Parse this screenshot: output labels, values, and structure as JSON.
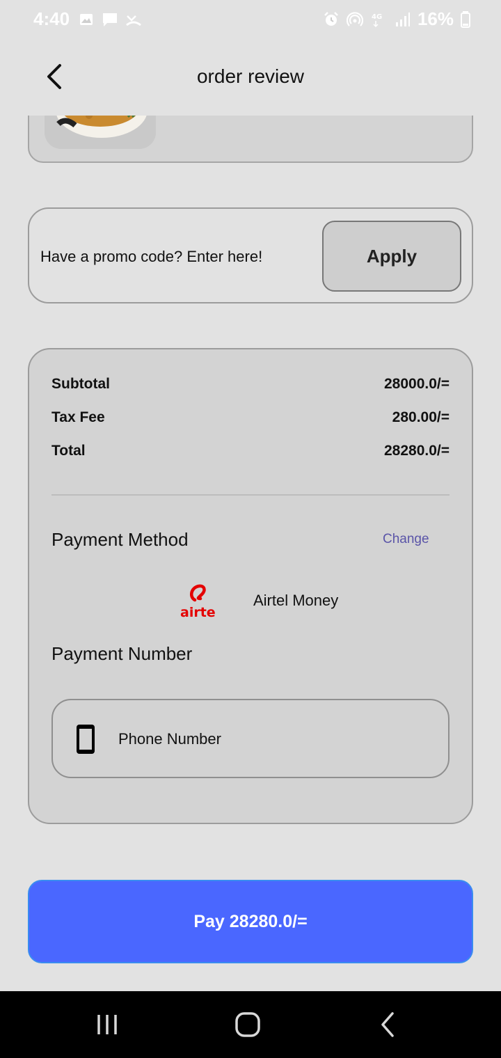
{
  "status_bar": {
    "time": "4:40",
    "battery": "16%",
    "left_icons": [
      "image-icon",
      "chat-icon",
      "missed-call-icon"
    ],
    "right_icons": [
      "alarm-icon",
      "hotspot-icon",
      "4g-icon",
      "signal-icon",
      "battery-icon"
    ]
  },
  "header": {
    "title": "order review",
    "back_icon": "chevron-left-icon"
  },
  "promo": {
    "placeholder": "Have a promo code? Enter here!",
    "apply_label": "Apply"
  },
  "summary": {
    "rows": [
      {
        "label": "Subtotal",
        "value": "28000.0/="
      },
      {
        "label": "Tax Fee",
        "value": "280.00/="
      },
      {
        "label": "Total",
        "value": "28280.0/="
      }
    ]
  },
  "payment": {
    "method_title": "Payment Method",
    "change_label": "Change",
    "logo_text": "airtel",
    "method_name": "Airtel Money",
    "number_title": "Payment Number",
    "phone_placeholder": "Phone Number"
  },
  "pay_button": {
    "label": "Pay 28280.0/="
  },
  "colors": {
    "accent": "#4a67ff",
    "link": "#5a54a8",
    "airtel_red": "#e40000",
    "background": "#e2e2e2"
  }
}
